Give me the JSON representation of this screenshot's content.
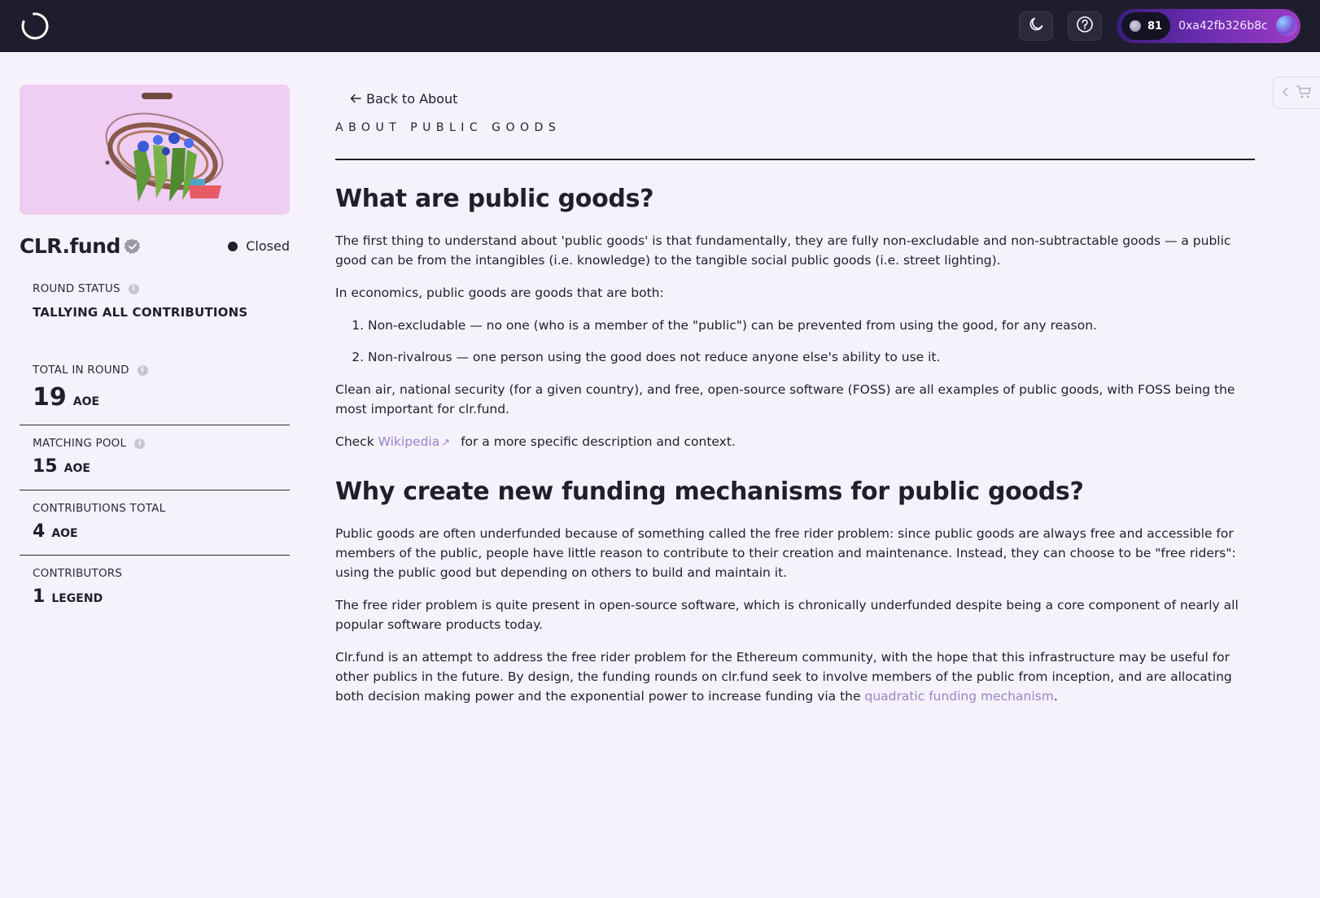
{
  "topbar": {
    "wallet_balance": "81",
    "wallet_address": "0xa42fb326b8c..."
  },
  "sidebar": {
    "round_name": "CLR.fund",
    "round_state": "Closed",
    "round_status_label": "ROUND STATUS",
    "round_status_value": "TALLYING ALL CONTRIBUTIONS",
    "stats": [
      {
        "label": "TOTAL IN ROUND",
        "value": "19",
        "unit": "AOE"
      },
      {
        "label": "MATCHING POOL",
        "value": "15",
        "unit": "AOE"
      },
      {
        "label": "CONTRIBUTIONS TOTAL",
        "value": "4",
        "unit": "AOE"
      },
      {
        "label": "CONTRIBUTORS",
        "value": "1",
        "unit": "LEGEND"
      }
    ]
  },
  "main": {
    "back_link": "Back to About",
    "eyebrow": "ABOUT PUBLIC GOODS",
    "heading1": "What are public goods?",
    "p1": "The first thing to understand about 'public goods' is that fundamentally, they are fully non-excludable and non-subtractable goods — a public good can be from the intangibles (i.e. knowledge) to the tangible social public goods (i.e. street lighting).",
    "p2": "In economics, public goods are goods that are both:",
    "list": [
      "Non-excludable — no one (who is a member of the \"public\") can be prevented from using the good, for any reason.",
      "Non-rivalrous — one person using the good does not reduce anyone else's ability to use it."
    ],
    "p3": "Clean air, national security (for a given country), and free, open-source software (FOSS) are all examples of public goods, with FOSS being the most important for clr.fund.",
    "p4_prefix": "Check",
    "p4_link": "Wikipedia",
    "p4_suffix": "for a more specific description and context.",
    "heading2": "Why create new funding mechanisms for public goods?",
    "p5": "Public goods are often underfunded because of something called the free rider problem: since public goods are always free and accessible for members of the public, people have little reason to contribute to their creation and maintenance. Instead, they can choose to be \"free riders\": using the public good but depending on others to build and maintain it.",
    "p6": "The free rider problem is quite present in open-source software, which is chronically underfunded despite being a core component of nearly all popular software products today.",
    "p7_prefix": "Clr.fund is an attempt to address the free rider problem for the Ethereum community, with the hope that this infrastructure may be useful for other publics in the future. By design, the funding rounds on clr.fund seek to involve members of the public from inception, and are allocating both decision making power and the exponential power to increase funding via the",
    "p7_link": "quadratic funding mechanism",
    "p7_suffix": "."
  },
  "icons": {
    "logo": "clrfund-logo-icon",
    "theme": "moon-icon",
    "help": "question-circle-icon",
    "cart": "cart-icon",
    "back": "arrow-left-icon",
    "external": "external-arrow-icon",
    "verified": "verified-badge-icon",
    "info": "info-icon"
  },
  "colors": {
    "topbar": "#1e1d2d",
    "background": "#f5f2fc",
    "link": "#9a84c8",
    "round_image_bg": "#f0cdf2"
  }
}
